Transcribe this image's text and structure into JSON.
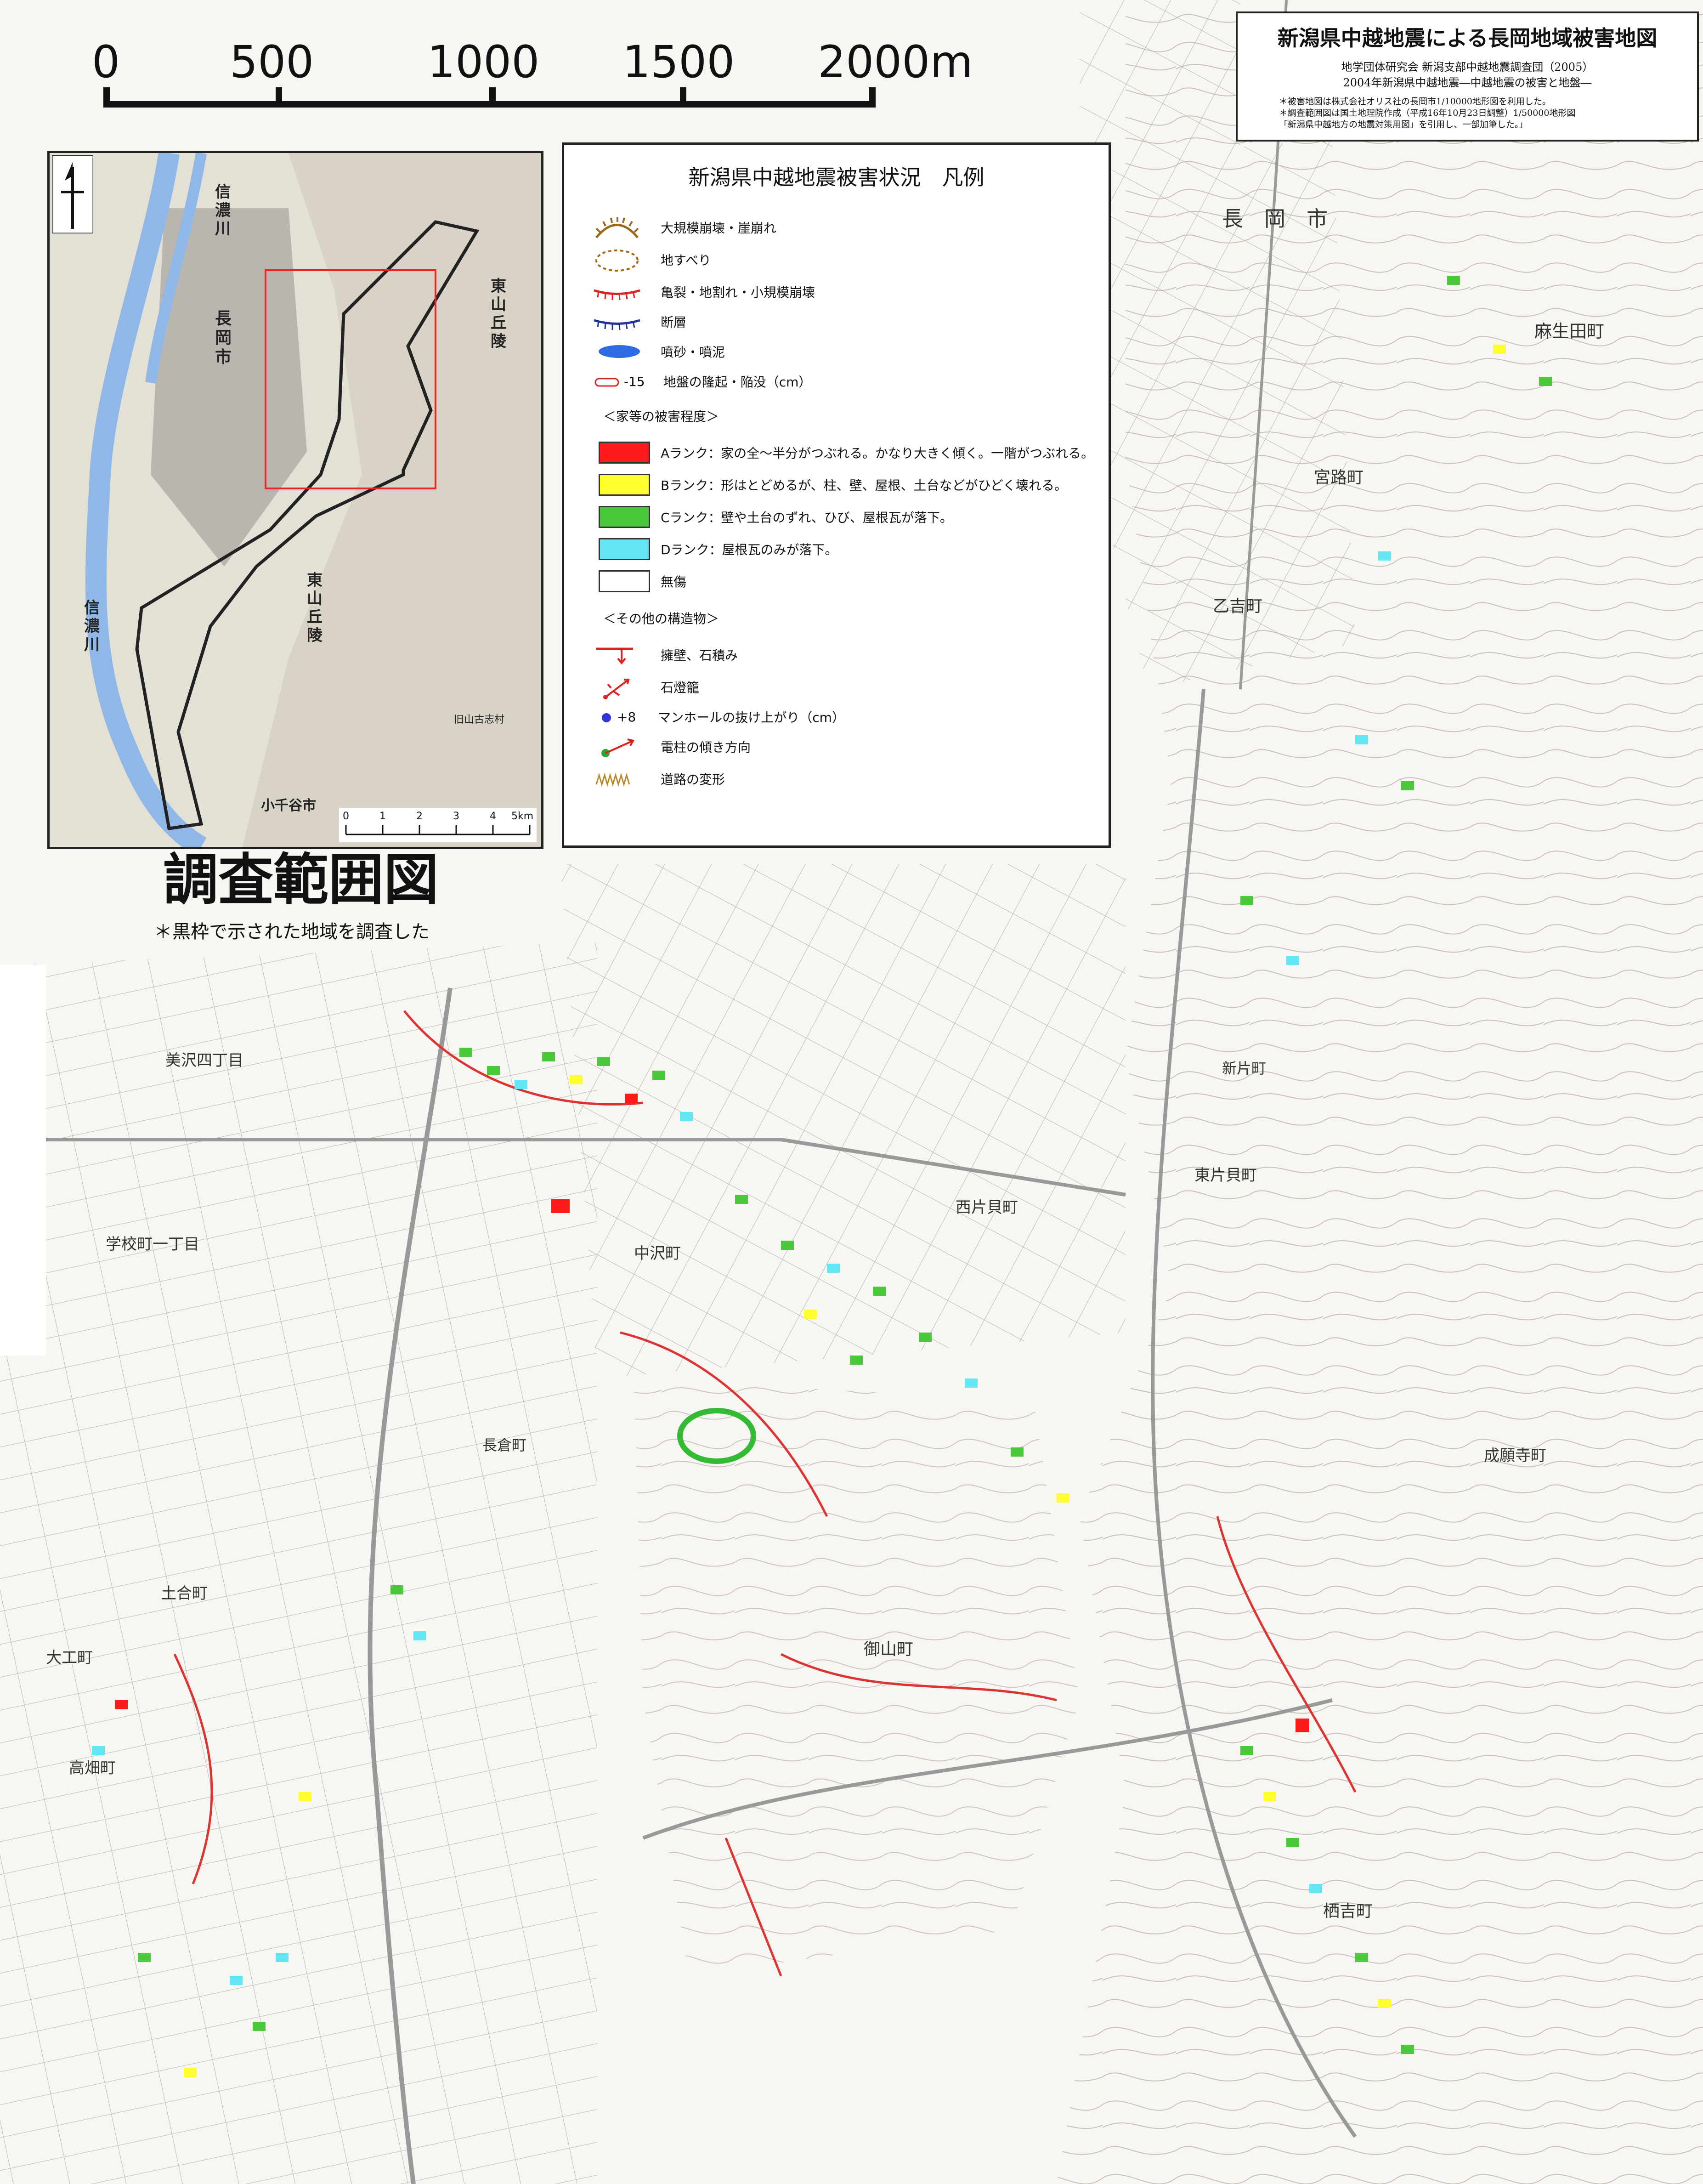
{
  "scale_bar": {
    "labels": [
      "0",
      "500",
      "1000",
      "1500",
      "2000m"
    ]
  },
  "title_box": {
    "title": "新潟県中越地震による長岡地域被害地図",
    "authors": "地学団体研究会 新潟支部中越地震調査団（2005）",
    "source": "2004年新潟県中越地震―中越地震の被害と地盤―",
    "note1": "＊被害地図は株式会社オリス社の長岡市1/10000地形図を利用した。",
    "note2": "＊調査範囲図は国土地理院作成（平成16年10月23日調整）1/50000地形図",
    "note3": "「新潟県中越地方の地震対策用図」を引用し、一部加筆した。」"
  },
  "inset": {
    "labels": {
      "river1": "信濃川",
      "river2": "信濃川",
      "city": "長岡市",
      "hills1": "東山丘陵",
      "hills2": "東山丘陵",
      "ojiya": "小千谷市",
      "village": "旧山古志村"
    },
    "scale_labels": [
      "0",
      "1",
      "2",
      "3",
      "4",
      "5km"
    ]
  },
  "legend": {
    "title": "新潟県中越地震被害状況　凡例",
    "rows": [
      {
        "label": "大規模崩壊・崖崩れ",
        "icon": "large-collapse-icon"
      },
      {
        "label": "地すべり",
        "icon": "landslide-icon"
      },
      {
        "label": "亀裂・地割れ・小規模崩壊",
        "icon": "crack-icon"
      },
      {
        "label": "断層",
        "icon": "fault-icon"
      },
      {
        "label": "噴砂・噴泥",
        "icon": "sand-boil-icon"
      },
      {
        "label": "地盤の隆起・陥没（cm）",
        "icon": "uplift-icon",
        "sample": "-15"
      }
    ],
    "house_header": "＜家等の被害程度＞",
    "ranks": [
      {
        "label": "Aランク：家の全〜半分がつぶれる。かなり大きく傾く。一階がつぶれる。",
        "color": "#ff1a1a"
      },
      {
        "label": "Bランク：形はとどめるが、柱、壁、屋根、土台などがひどく壊れる。",
        "color": "#ffff2e"
      },
      {
        "label": "Cランク：壁や土台のずれ、ひび、屋根瓦が落下。",
        "color": "#4cc93a"
      },
      {
        "label": "Dランク：屋根瓦のみが落下。",
        "color": "#63e6f2"
      },
      {
        "label": "無傷",
        "color": "#ffffff"
      }
    ],
    "struct_header": "＜その他の構造物＞",
    "structures": [
      {
        "label": "擁壁、石積み",
        "icon": "retaining-wall-icon"
      },
      {
        "label": "石燈籠",
        "icon": "stone-lantern-icon"
      },
      {
        "label": "マンホールの抜け上がり（cm）",
        "icon": "manhole-icon",
        "sample": "+8"
      },
      {
        "label": "電柱の傾き方向",
        "icon": "utility-pole-icon"
      },
      {
        "label": "道路の変形",
        "icon": "road-deformation-icon"
      }
    ]
  },
  "survey": {
    "title": "調査範囲図",
    "note": "＊黒枠で示された地域を調査した"
  },
  "map_labels": {
    "nagaoka": "長　岡　市",
    "asouda": "麻生田町",
    "miyajicho": "宮路町",
    "otokichi": "乙吉町",
    "nakazawa": "中沢町",
    "nishikatakai": "西片貝町",
    "higashikatakai": "東片貝町",
    "miyuki": "御山町",
    "suyoshi": "栖吉町",
    "gakko": "学校町一丁目",
    "misawa": "美沢四丁目",
    "kokura": "長倉町",
    "joganji": "成願寺町",
    "takabata": "高畑町",
    "tsuchiai": "土合町",
    "daiku": "大工町",
    "shinkata": "新片町"
  }
}
